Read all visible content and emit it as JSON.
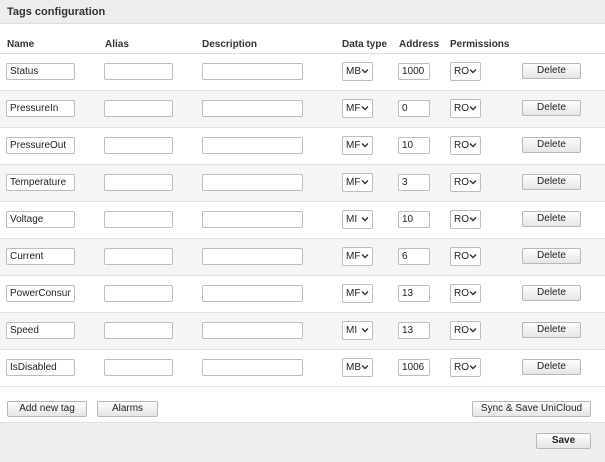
{
  "panel": {
    "title": "Tags configuration"
  },
  "columns": {
    "name": "Name",
    "alias": "Alias",
    "description": "Description",
    "data_type": "Data type",
    "address": "Address",
    "permissions": "Permissions"
  },
  "rows": [
    {
      "name": "Status",
      "alias": "",
      "description": "",
      "data_type": "MB",
      "address": "1000",
      "permissions": "RO",
      "delete_label": "Delete"
    },
    {
      "name": "PressureIn",
      "alias": "",
      "description": "",
      "data_type": "MF",
      "address": "0",
      "permissions": "RO",
      "delete_label": "Delete"
    },
    {
      "name": "PressureOut",
      "alias": "",
      "description": "",
      "data_type": "MF",
      "address": "10",
      "permissions": "RO",
      "delete_label": "Delete"
    },
    {
      "name": "Temperature",
      "alias": "",
      "description": "",
      "data_type": "MF",
      "address": "3",
      "permissions": "RO",
      "delete_label": "Delete"
    },
    {
      "name": "Voltage",
      "alias": "",
      "description": "",
      "data_type": "MI",
      "address": "10",
      "permissions": "RO",
      "delete_label": "Delete"
    },
    {
      "name": "Current",
      "alias": "",
      "description": "",
      "data_type": "MF",
      "address": "6",
      "permissions": "RO",
      "delete_label": "Delete"
    },
    {
      "name": "PowerConsumpti",
      "alias": "",
      "description": "",
      "data_type": "MF",
      "address": "13",
      "permissions": "RO",
      "delete_label": "Delete"
    },
    {
      "name": "Speed",
      "alias": "",
      "description": "",
      "data_type": "MI",
      "address": "13",
      "permissions": "RO",
      "delete_label": "Delete"
    },
    {
      "name": "IsDisabled",
      "alias": "",
      "description": "",
      "data_type": "MB",
      "address": "1006",
      "permissions": "RO",
      "delete_label": "Delete"
    }
  ],
  "actions": {
    "add_new_tag": "Add new tag",
    "alarms": "Alarms",
    "sync_save": "Sync & Save UniCloud",
    "save": "Save"
  },
  "icons": {
    "dropdown": "chevron-down-icon"
  },
  "colors": {
    "header_bg": "#ededed",
    "row_alt_bg": "#f5f5f5",
    "footer_bg": "#efefef",
    "border": "#bdbdbd"
  }
}
